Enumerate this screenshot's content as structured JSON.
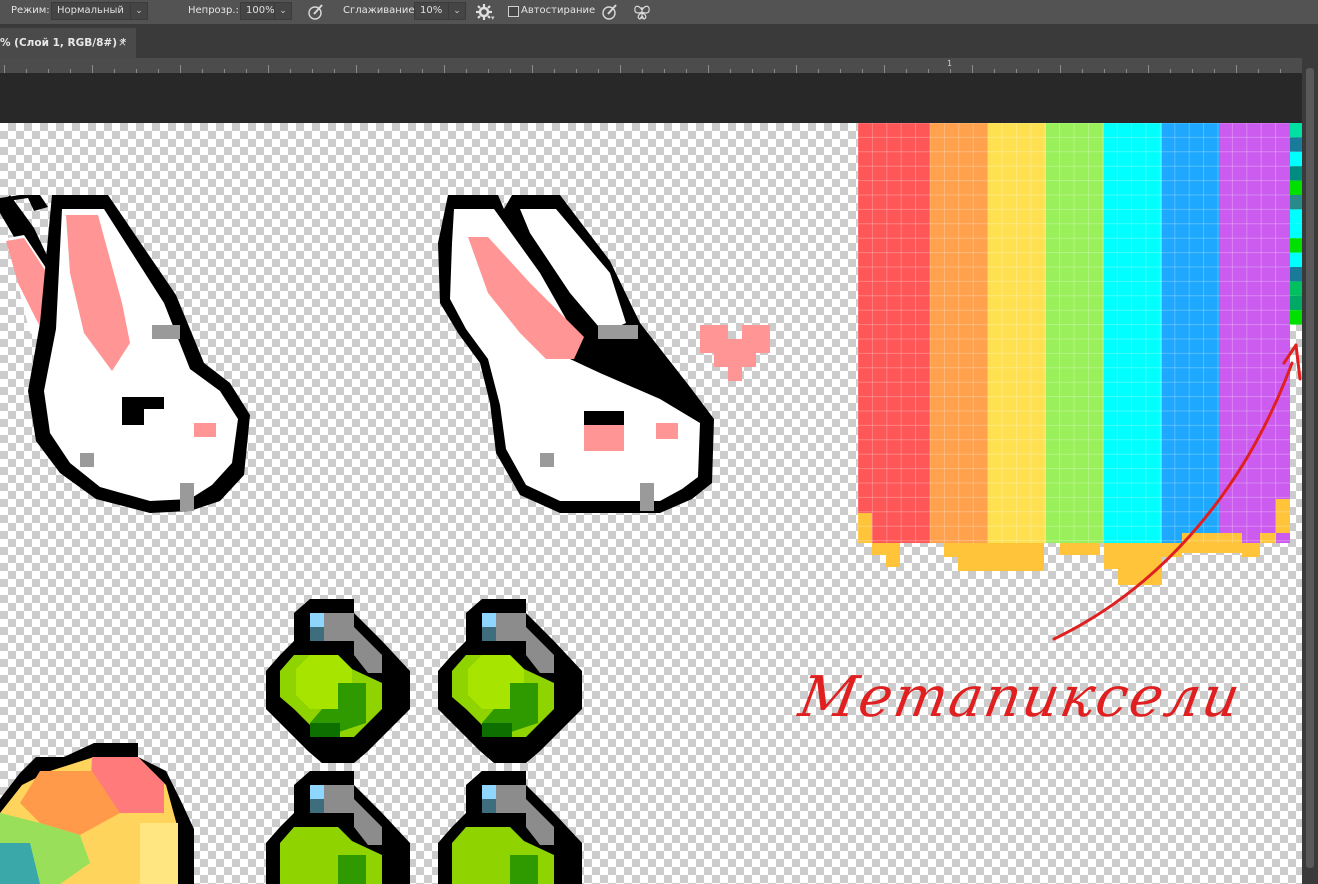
{
  "options_bar": {
    "mode_label": "Режим:",
    "mode_value": "Нормальный",
    "opacity_label": "Непрозр.:",
    "opacity_value": "100%",
    "smoothing_label": "Сглаживание:",
    "smoothing_value": "10%",
    "autoerase_label": "Автостирание",
    "autoerase_checked": false
  },
  "tab": {
    "title": "% (Слой 1, RGB/8#) *",
    "close": "×"
  },
  "ruler": {
    "label": "1"
  },
  "canvas": {
    "annotation": "Метапиксели",
    "annotation_color": "#e02020"
  },
  "icons": [
    "pressure-opacity-icon",
    "settings-gear-icon",
    "pressure-size-icon",
    "symmetry-butterfly-icon",
    "close-icon",
    "chevron-down-icon"
  ],
  "colors": {
    "ui_bar": "#535353",
    "pasteboard": "#282828",
    "rainbow": [
      "#ff5757",
      "#ffa14d",
      "#ffe050",
      "#99f05a",
      "#00ffff",
      "#1ea8ff",
      "#cc5cf0"
    ],
    "drip": "#ffc43a"
  }
}
